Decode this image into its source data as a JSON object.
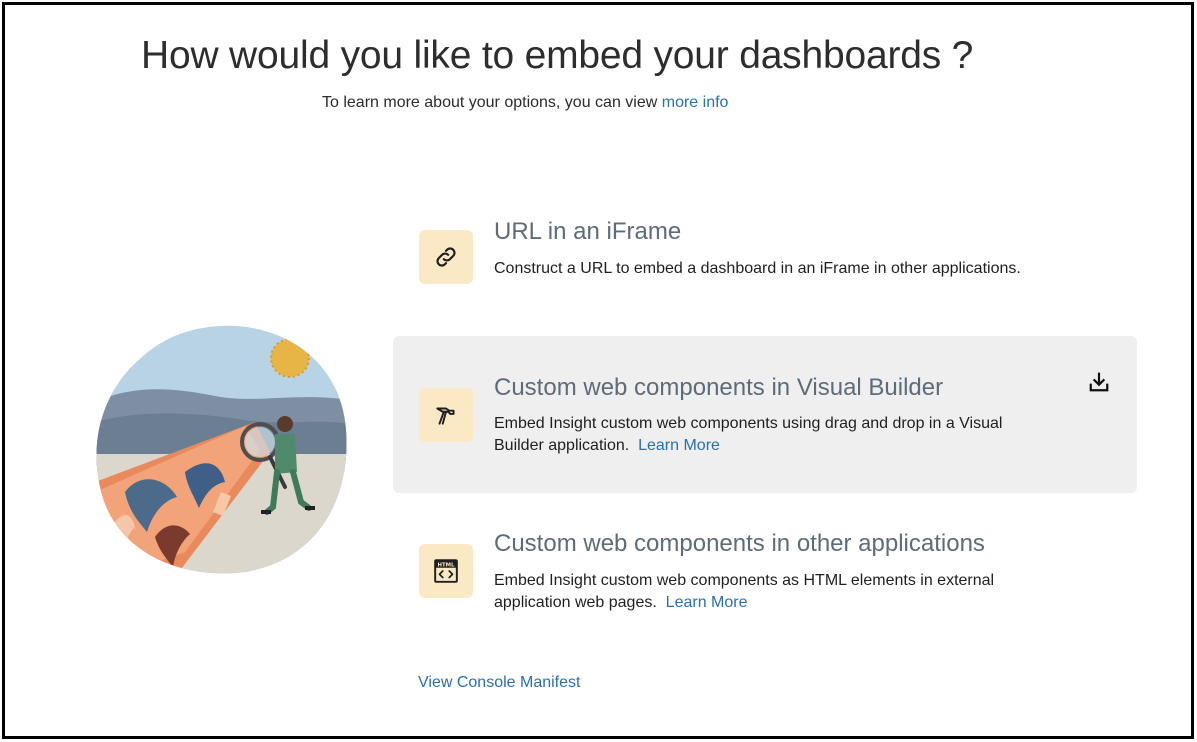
{
  "header": {
    "title": "How would you like to embed your dashboards ?",
    "subtitle_text": "To learn more about your options, you can view",
    "subtitle_link": "more info"
  },
  "options": [
    {
      "title": "URL in an iFrame",
      "description": "Construct a URL to embed a dashboard in an iFrame in other applications.",
      "link": "",
      "icon": "link-icon",
      "selected": false
    },
    {
      "title": "Custom web components in Visual Builder",
      "description": "Embed Insight custom web components using drag and drop in a Visual Builder application.",
      "link": "Learn More",
      "icon": "hammer-icon",
      "selected": true,
      "action_icon": "download-icon"
    },
    {
      "title": "Custom web components in other applications",
      "description": "Embed Insight custom web components as HTML elements in external application web pages.",
      "link": "Learn More",
      "icon": "html-icon",
      "selected": false
    }
  ],
  "footer": {
    "console_link": "View Console Manifest"
  },
  "colors": {
    "accent_link": "#2a6fb0",
    "icon_tile": "#fbe9c6",
    "selected_bg": "#efefef",
    "title_gray": "#5e6b78"
  }
}
